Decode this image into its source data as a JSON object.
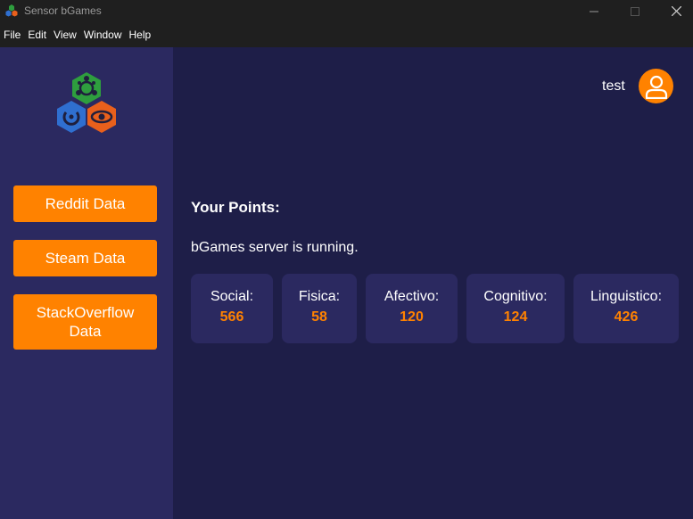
{
  "window": {
    "title": "Sensor bGames",
    "app_icon": "bgames-logo-icon"
  },
  "menu": {
    "items": [
      "File",
      "Edit",
      "View",
      "Window",
      "Help"
    ]
  },
  "sidebar": {
    "logo": "bgames-logo-icon",
    "buttons": [
      {
        "label": "Reddit Data"
      },
      {
        "label": "Steam Data"
      },
      {
        "label": "StackOverflow Data"
      }
    ]
  },
  "header": {
    "username": "test",
    "avatar_icon": "user-icon"
  },
  "main": {
    "points_title": "Your Points:",
    "server_status": "bGames server is running.",
    "cards": [
      {
        "label": "Social:",
        "value": "566"
      },
      {
        "label": "Fisica:",
        "value": "58"
      },
      {
        "label": "Afectivo:",
        "value": "120"
      },
      {
        "label": "Cognitivo:",
        "value": "124"
      },
      {
        "label": "Linguistico:",
        "value": "426"
      }
    ]
  },
  "colors": {
    "accent": "#ff8200",
    "sidebar_bg": "#2b2960",
    "main_bg": "#1e1e48",
    "card_bg": "#2b2960",
    "titlebar_bg": "#1f1f1f"
  }
}
